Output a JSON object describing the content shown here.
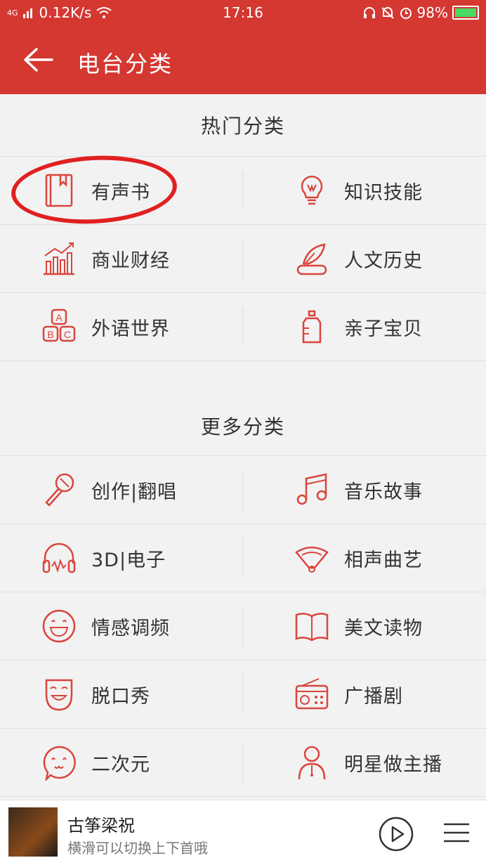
{
  "status": {
    "network": "4G",
    "speed": "0.12K/s",
    "time": "17:16",
    "battery": "98%"
  },
  "header": {
    "title": "电台分类"
  },
  "hot": {
    "heading": "热门分类",
    "items": [
      {
        "label": "有声书",
        "icon": "book-icon"
      },
      {
        "label": "知识技能",
        "icon": "lightbulb-icon"
      },
      {
        "label": "商业财经",
        "icon": "bar-chart-icon"
      },
      {
        "label": "人文历史",
        "icon": "quill-scroll-icon"
      },
      {
        "label": "外语世界",
        "icon": "abc-blocks-icon"
      },
      {
        "label": "亲子宝贝",
        "icon": "baby-bottle-icon"
      }
    ]
  },
  "more": {
    "heading": "更多分类",
    "items": [
      {
        "label": "创作|翻唱",
        "icon": "microphone-icon"
      },
      {
        "label": "音乐故事",
        "icon": "music-note-icon"
      },
      {
        "label": "3D|电子",
        "icon": "headphones-icon"
      },
      {
        "label": "相声曲艺",
        "icon": "fan-icon"
      },
      {
        "label": "情感调频",
        "icon": "smiley-icon"
      },
      {
        "label": "美文读物",
        "icon": "open-book-icon"
      },
      {
        "label": "脱口秀",
        "icon": "mask-icon"
      },
      {
        "label": "广播剧",
        "icon": "radio-icon"
      },
      {
        "label": "二次元",
        "icon": "anime-face-icon"
      },
      {
        "label": "明星做主播",
        "icon": "star-person-icon"
      }
    ]
  },
  "player": {
    "title": "古筝梁祝",
    "subtitle": "横滑可以切换上下首哦"
  },
  "colors": {
    "primary": "#d43831",
    "icon": "#d9453d"
  }
}
